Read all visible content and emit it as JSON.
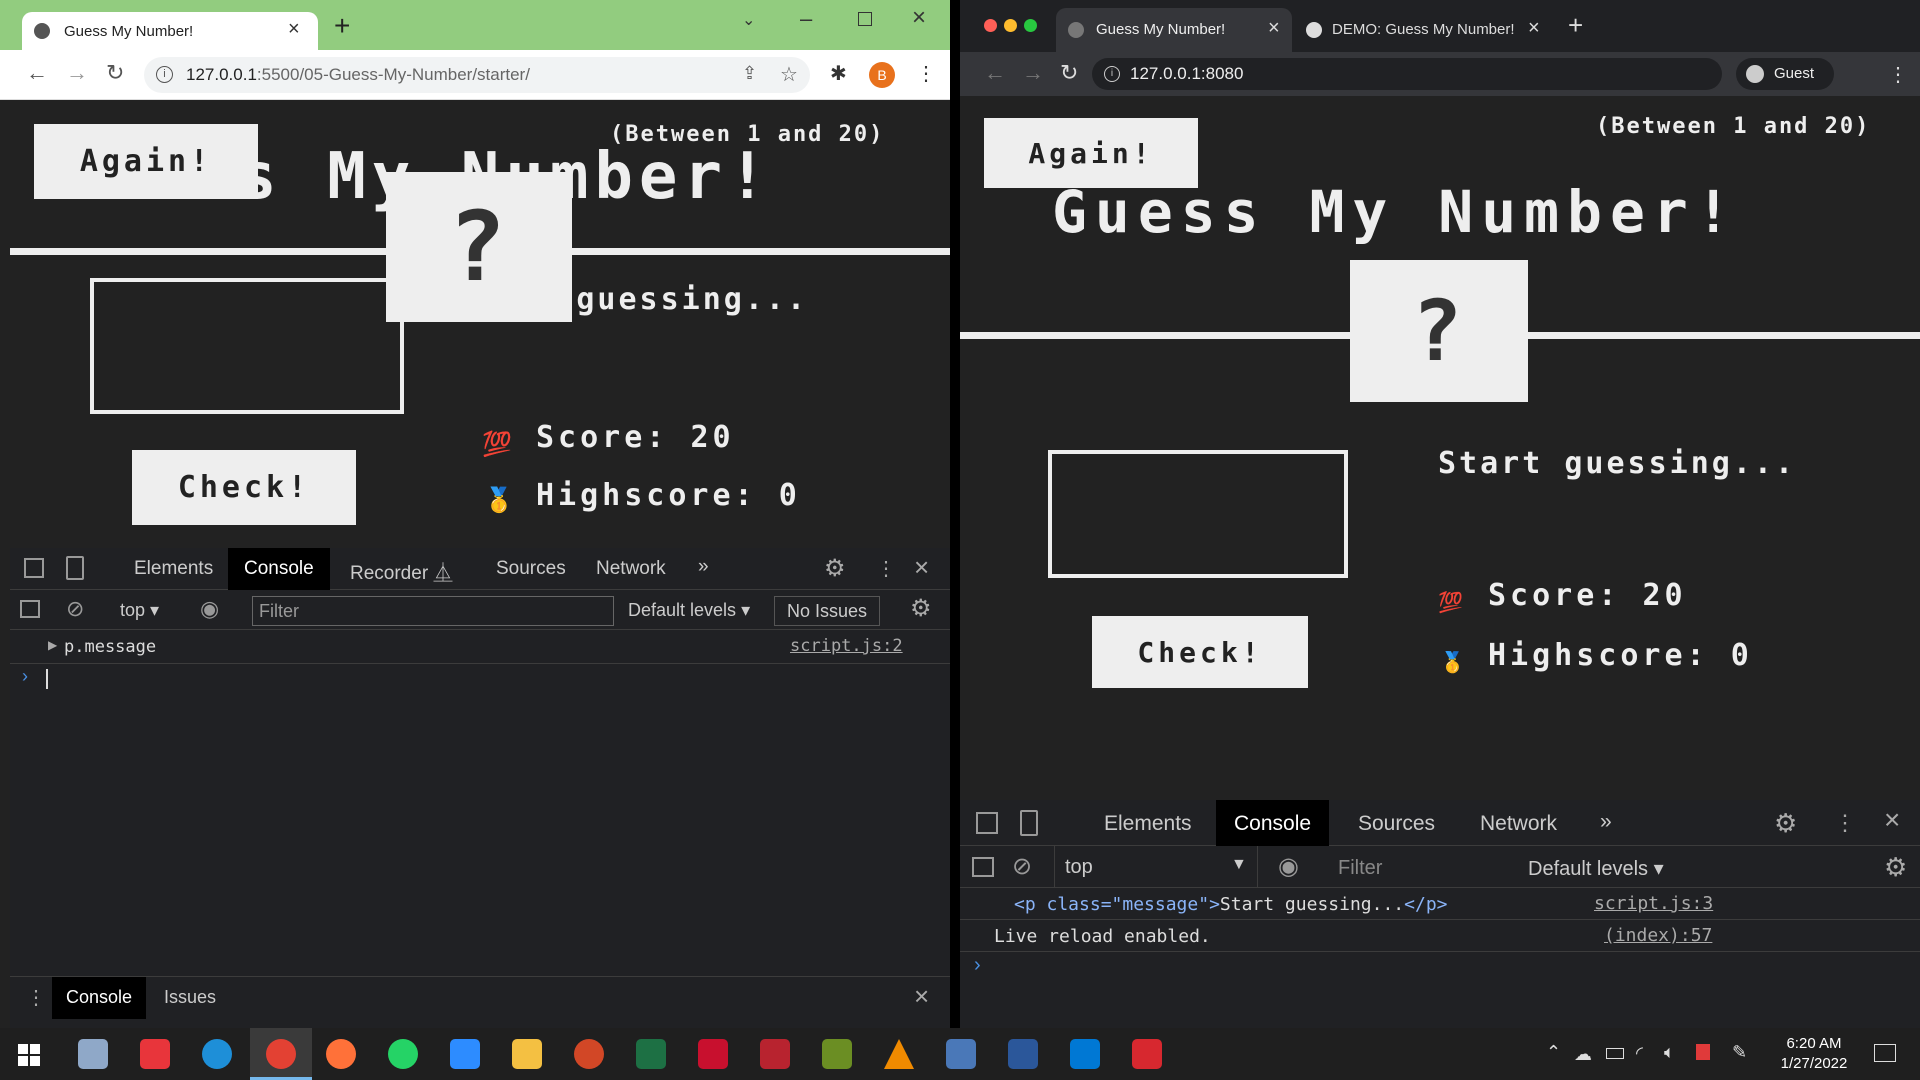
{
  "left": {
    "tab_title": "Guess My Number!",
    "url_host": "127.0.0.1",
    "url_path": ":5500/05-Guess-My-Number/starter/",
    "profile_initial": "B",
    "game": {
      "between": "(Between 1 and 20)",
      "again": "Again!",
      "title": "Guess My Number!",
      "question": "?",
      "message": "Start guessing...",
      "check": "Check!",
      "score_label": "Score: ",
      "score": "20",
      "highscore_label": "Highscore: ",
      "highscore": "0",
      "score_icon": "💯",
      "highscore_icon": "🥇"
    },
    "devtools": {
      "tabs": [
        "Elements",
        "Console",
        "Recorder",
        "Sources",
        "Network"
      ],
      "context": "top",
      "filter_placeholder": "Filter",
      "levels": "Default levels",
      "issues": "No Issues",
      "log_entry": "p.message",
      "log_source": "script.js:2",
      "drawer_tabs": [
        "Console",
        "Issues"
      ]
    }
  },
  "right": {
    "tabs": [
      "Guess My Number!",
      "DEMO: Guess My Number!"
    ],
    "url": "127.0.0.1:8080",
    "profile": "Guest",
    "game": {
      "between": "(Between 1 and 20)",
      "again": "Again!",
      "title": "Guess My Number!",
      "question": "?",
      "message": "Start guessing...",
      "check": "Check!",
      "score_label": "Score: ",
      "score": "20",
      "highscore_label": "Highscore: ",
      "highscore": "0"
    },
    "devtools": {
      "tabs": [
        "Elements",
        "Console",
        "Sources",
        "Network"
      ],
      "context": "top",
      "filter_placeholder": "Filter",
      "levels": "Default levels",
      "log_open": "<p class=\"message\">",
      "log_text": "Start guessing...",
      "log_close": "</p>",
      "log_source": "script.js:3",
      "log2": "Live reload enabled.",
      "log2_source": "(index):57"
    }
  },
  "taskbar": {
    "time": "6:20 AM",
    "date": "1/27/2022"
  },
  "colors": {
    "page_bg": "#222222",
    "light": "#eeeeee",
    "chrome_green": "#92cc7f"
  }
}
